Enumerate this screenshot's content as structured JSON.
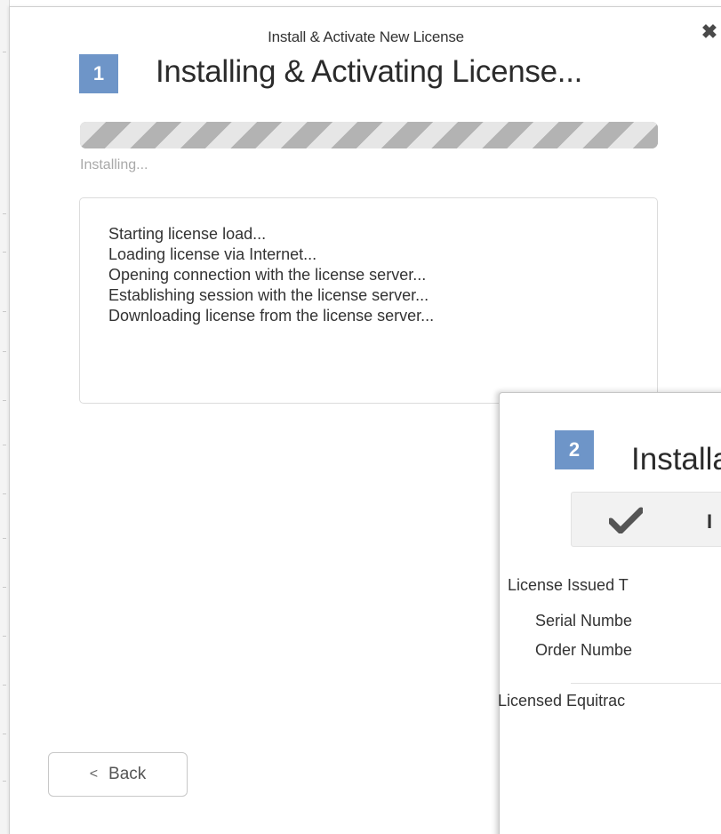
{
  "dialog1": {
    "window_title": "Install & Activate New License",
    "close_glyph": "✖",
    "step_number": "1",
    "heading": "Installing & Activating License...",
    "progress": {
      "status_text": "Installing...",
      "fraction": 1.0,
      "style": "indeterminate-striped"
    },
    "log_lines": [
      "Starting license load...",
      "Loading license via Internet...",
      "Opening connection with the license server...",
      "Establishing session with the license server...",
      "Downloading license from the license server..."
    ],
    "back_button": {
      "chevron": "<",
      "label": "Back"
    }
  },
  "dialog2": {
    "step_number": "2",
    "heading": "Installa",
    "status_icon": "checkmark-icon",
    "status_text": "I",
    "fields": [
      {
        "label": "License Issued T"
      },
      {
        "label": "Serial Numbe"
      },
      {
        "label": "Order Numbe"
      }
    ],
    "footer_label": "Licensed Equitrac"
  },
  "colors": {
    "badge": "#6e95c8",
    "progress_stripe_dark": "#b3b3b3",
    "progress_stripe_light": "#e6e6e6",
    "status_box_bg": "#f2f2f2"
  }
}
